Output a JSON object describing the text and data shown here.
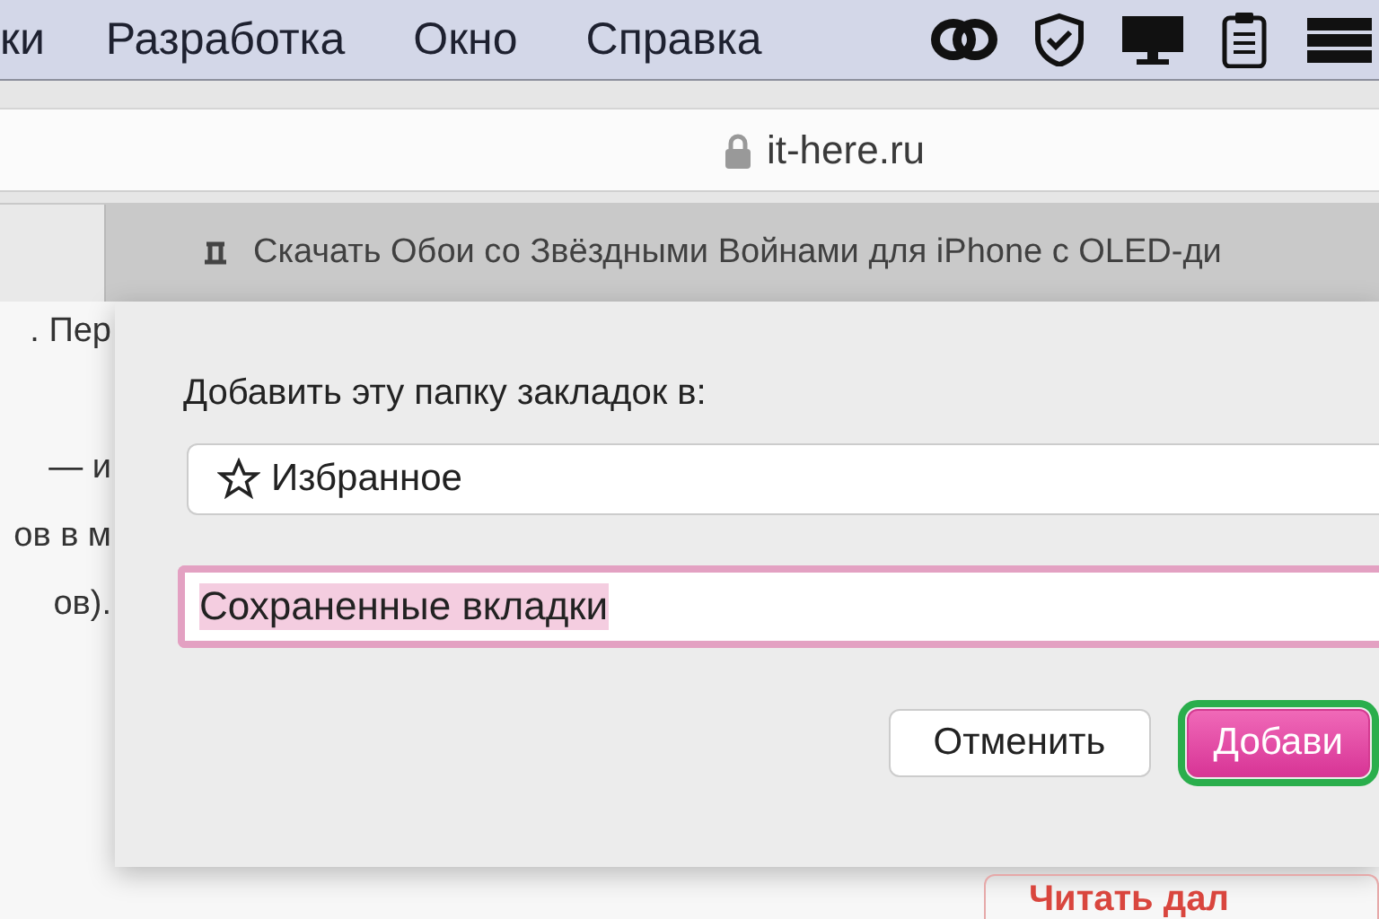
{
  "menu_bar": {
    "items": [
      "ки",
      "Разработка",
      "Окно",
      "Справка"
    ]
  },
  "address_bar": {
    "url": "it-here.ru",
    "secure": true
  },
  "tab": {
    "title": "Скачать Обои со Звёздными Войнами для iPhone с OLED-ди"
  },
  "page": {
    "lines": [
      ". Пер",
      "— и",
      "ов в м",
      "ов)."
    ],
    "link_button": "Читать дал"
  },
  "dialog": {
    "prompt": "Добавить эту папку закладок в:",
    "folder": "Избранное",
    "name_field": {
      "value": "Сохраненные вкладки",
      "focused": true,
      "text_selected": true
    },
    "buttons": [
      {
        "label": "Отменить",
        "kind": "secondary",
        "highlighted": false
      },
      {
        "label": "Добави",
        "kind": "primary",
        "highlighted": true
      }
    ]
  }
}
